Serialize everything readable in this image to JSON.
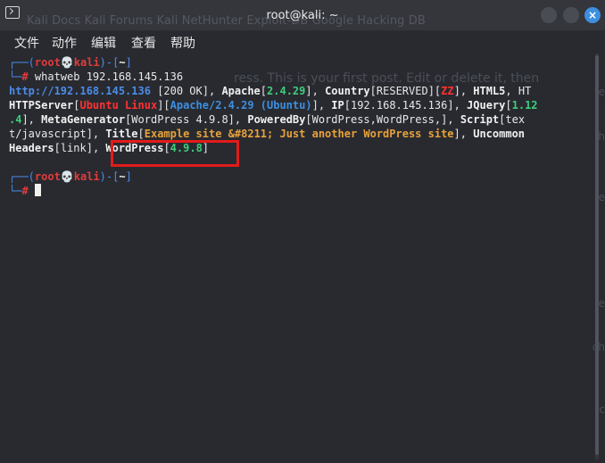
{
  "window": {
    "title": "root@kali: ~",
    "background_tabs": "Kali Docs   Kali Forums   Kali NetHunter   Exploit-DB   Google Hacking DB",
    "close_label": "×"
  },
  "menubar": {
    "items": [
      "文件",
      "动作",
      "编辑",
      "查看",
      "帮助"
    ]
  },
  "background_text": {
    "post": "ress. This is your first post. Edit or delete it, then",
    "right_fragments": [
      "re",
      "h",
      "e",
      "e",
      "ch",
      "c"
    ]
  },
  "terminal": {
    "prompt_user": "root",
    "prompt_host": "kali",
    "prompt_path": "~",
    "command": "whatweb 192.168.145.136",
    "output": {
      "url": "http://192.168.145.136",
      "status": "[200 OK]",
      "apache_label": "Apache",
      "apache_version": "2.4.29",
      "country_label": "Country",
      "country_value": "RESERVED",
      "country_code": "ZZ",
      "html5": "HTML5",
      "httpserver_label": "HTTPServer",
      "httpserver_os": "Ubuntu Linux",
      "httpserver_value": "Apache/2.4.29 (Ubuntu)",
      "ip_label": "IP",
      "ip_value": "192.168.145.136",
      "jquery_label": "JQuery",
      "jquery_version_a": "1.12",
      "jquery_version_b": ".4",
      "metagenerator_label": "MetaGenerator",
      "metagenerator_value": "WordPress 4.9.8",
      "poweredby_label": "PoweredBy",
      "poweredby_value": "WordPress,WordPress,",
      "script_label": "Script",
      "script_value_a": "tex",
      "script_value_b": "t/javascript",
      "title_label": "Title",
      "title_value": "Example site &#8211; Just another WordPress site",
      "uncommon_label": "Uncommon",
      "uncommon_label_b": "Headers",
      "uncommon_value": "link",
      "wordpress_label": "WordPress",
      "wordpress_version": "4.9.8"
    }
  },
  "colors": {
    "prompt_bracket": "#4c8ce8",
    "prompt_user": "#e33b3b",
    "version_green": "#3ccf7a",
    "title_orange": "#e8a23a",
    "highlight_red": "#e31b1b"
  }
}
